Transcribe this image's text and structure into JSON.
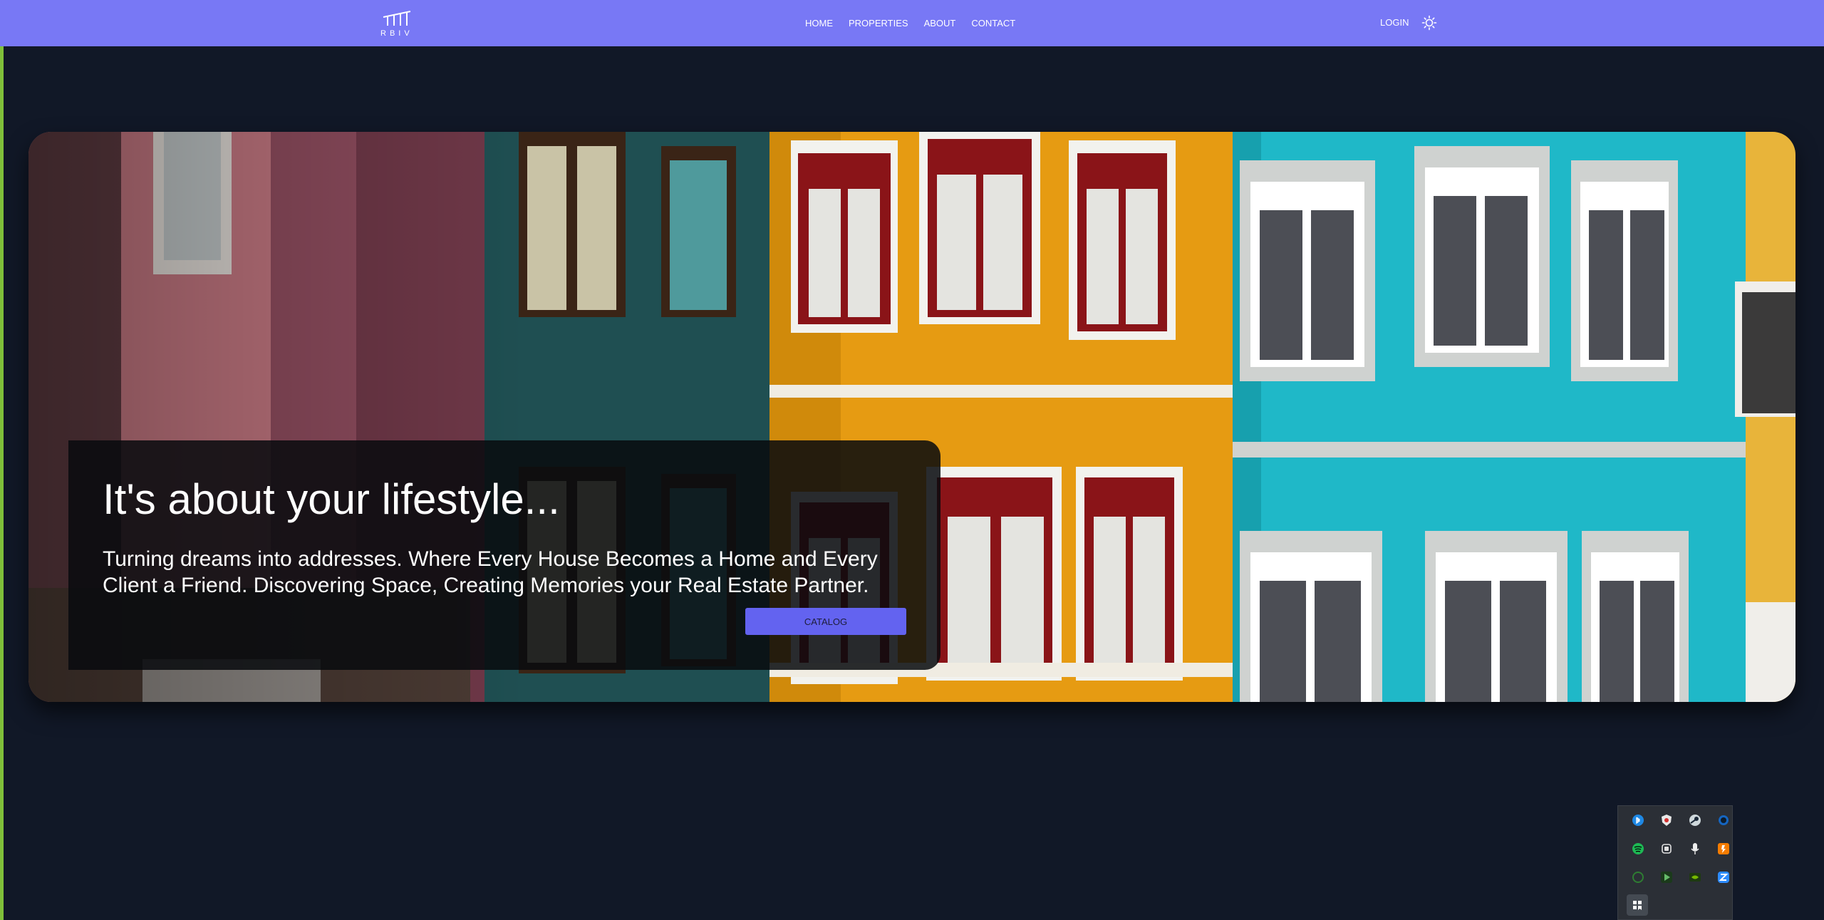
{
  "brand": {
    "logo_text": "RBIV"
  },
  "nav": {
    "links": [
      "HOME",
      "PROPERTIES",
      "ABOUT",
      "CONTACT"
    ],
    "login_label": "LOGIN",
    "theme_icon": "sun-icon"
  },
  "hero": {
    "headline": "It's about your lifestyle...",
    "description": "Turning dreams into addresses. Where Every House Becomes a Home and Every Client a Friend. Discovering Space, Creating Memories your Real Estate Partner.",
    "cta_label": "CATALOG"
  },
  "tray": {
    "icons": [
      "bluetooth-icon",
      "shield-icon",
      "steam-icon",
      "circle-app-icon",
      "spotify-icon",
      "copy-app-icon",
      "microphone-icon",
      "orange-app-icon",
      "green-circle-icon",
      "play-icon",
      "nvidia-icon",
      "zoom-icon",
      "bookmark-icon"
    ]
  },
  "colors": {
    "navbar": "#7878f5",
    "page_bg": "#111827",
    "cta": "#6363f0"
  }
}
